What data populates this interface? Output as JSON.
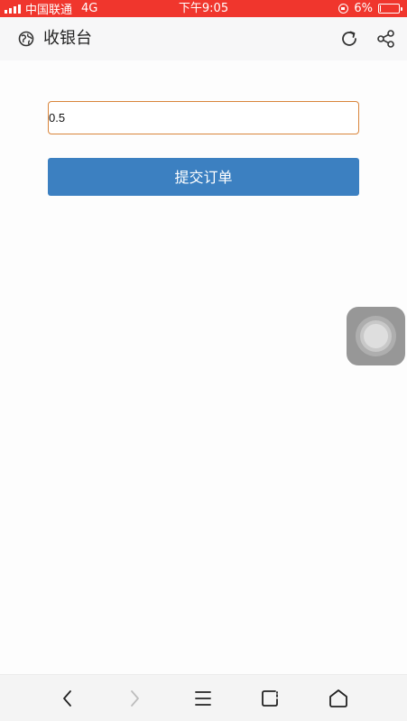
{
  "status_bar": {
    "carrier": "中国联通",
    "network": "4G",
    "time": "下午9:05",
    "battery": "6%",
    "battery_level": 0.06
  },
  "header": {
    "title": "收银台",
    "icons": {
      "left": "globe-icon",
      "refresh": "refresh-icon",
      "share": "share-icon"
    }
  },
  "form": {
    "amount_value": "0.5",
    "submit_label": "提交订单"
  },
  "colors": {
    "status_bar": "#f0362d",
    "input_border": "#d9853b",
    "submit_button": "#3c80c1"
  },
  "bottom_nav": {
    "icons": [
      "back-icon",
      "forward-icon",
      "menu-icon",
      "tabs-icon",
      "home-icon"
    ]
  }
}
